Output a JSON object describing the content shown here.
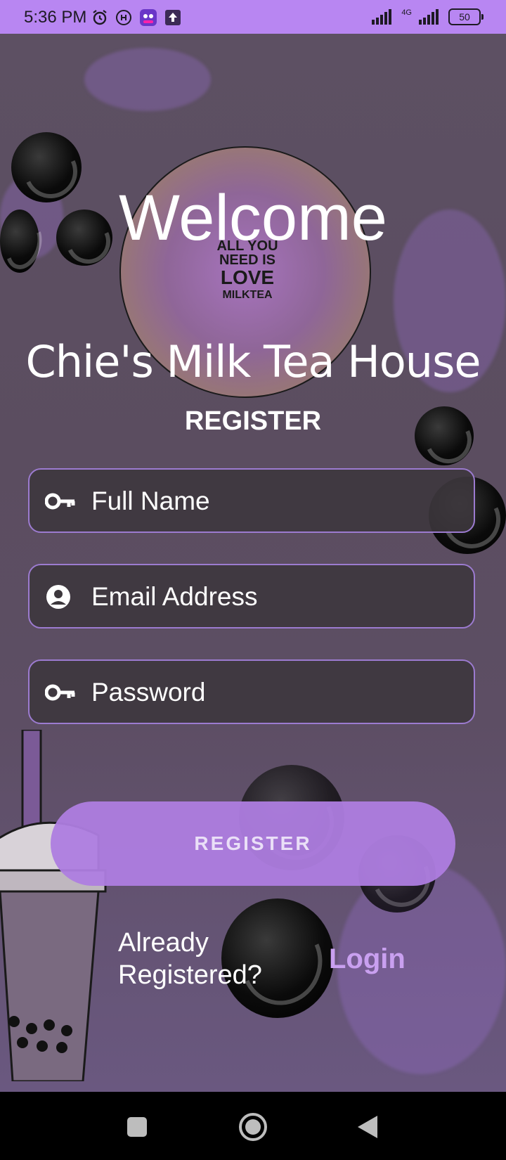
{
  "status_bar": {
    "time": "5:36 PM",
    "network": "4G",
    "battery": "50",
    "icons": [
      "alarm-icon",
      "hotspot-icon",
      "app-notification-icon",
      "upload-icon",
      "signal-icon",
      "signal-4g-icon",
      "battery-icon"
    ]
  },
  "welcome": "Welcome",
  "shop_name": "Chie's Milk Tea House",
  "form": {
    "title": "REGISTER",
    "full_name_placeholder": "Full Name",
    "email_placeholder": "Email Address",
    "password_placeholder": "Password",
    "submit_label": "REGISTER"
  },
  "footer": {
    "already_line1": "Already",
    "already_line2": "Registered?",
    "login_label": "Login"
  },
  "logo": {
    "line1": "ALL YOU",
    "line2": "NEED IS",
    "line3": "LOVE",
    "line4": "MILKTEA"
  },
  "colors": {
    "accent": "#b886f2",
    "button": "#ae7de0",
    "link": "#c9a0f0"
  }
}
